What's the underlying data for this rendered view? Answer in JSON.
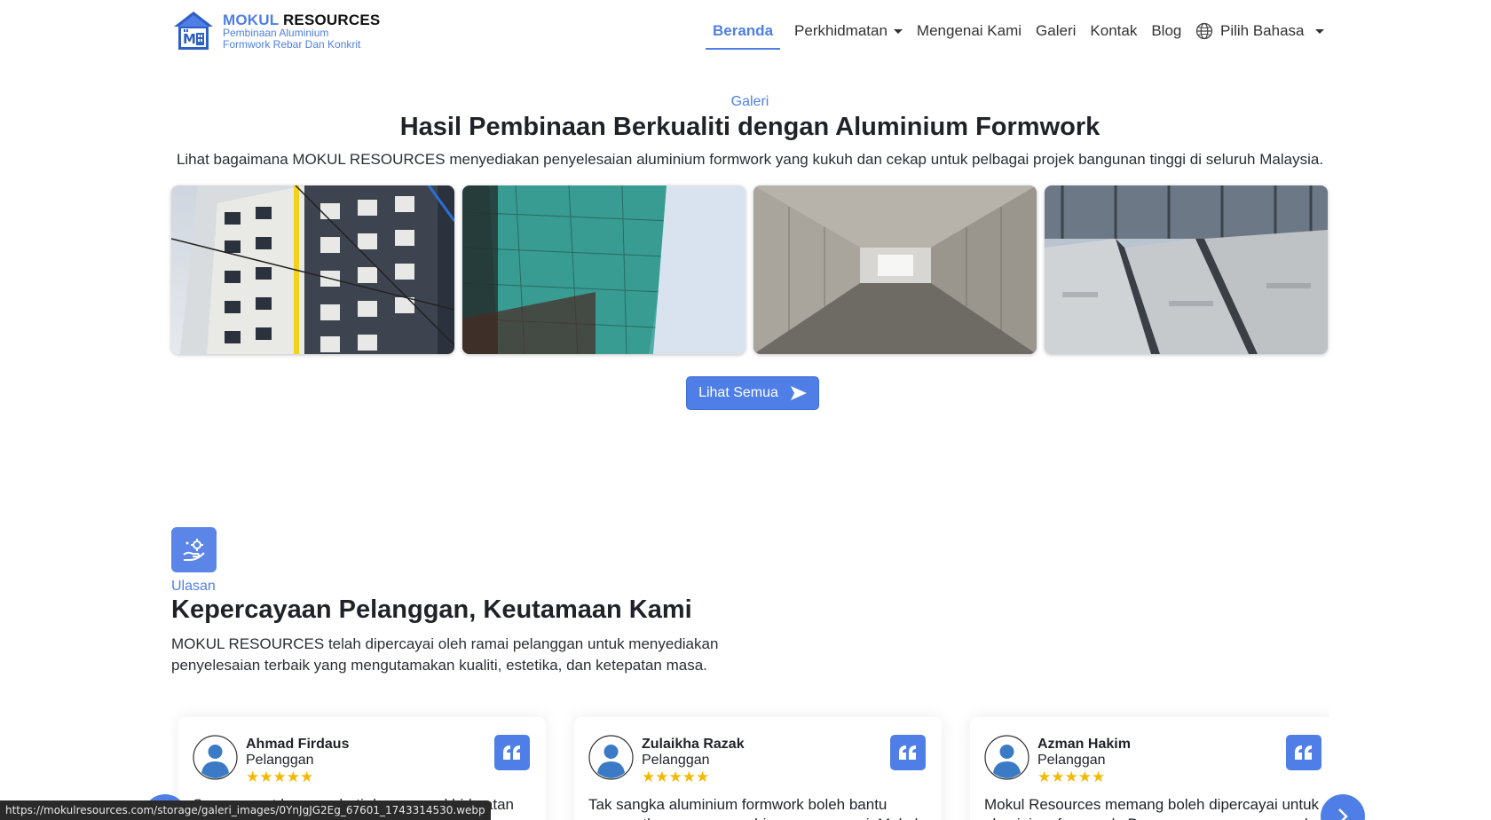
{
  "brand": {
    "name_accent": "MOKUL",
    "name_rest": "RESOURCES",
    "sub_line1": "Pembinaan Aluminium",
    "sub_line2": "Formwork Rebar Dan Konkrit"
  },
  "nav": {
    "items": [
      "Beranda",
      "Perkhidmatan",
      "Mengenai Kami",
      "Galeri",
      "Kontak",
      "Blog"
    ],
    "active": "Beranda",
    "language_label": "Pilih Bahasa"
  },
  "gallery": {
    "eyebrow": "Galeri",
    "title": "Hasil Pembinaan Berkualiti dengan Aluminium Formwork",
    "description": "Lihat bagaimana MOKUL RESOURCES menyediakan penyelesaian aluminium formwork yang kukuh dan cekap untuk pelbagai projek bangunan tinggi di seluruh Malaysia.",
    "view_all_label": "Lihat Semua"
  },
  "reviews": {
    "eyebrow": "Ulasan",
    "title": "Kepercayaan Pelanggan, Keutamaan Kami",
    "description": "MOKUL RESOURCES telah dipercayai oleh ramai pelanggan untuk menyediakan penyelesaian terbaik yang mengutamakan kualiti, estetika, dan ketepatan masa.",
    "cards": [
      {
        "name": "Ahmad Firdaus",
        "role": "Pelanggan",
        "rating": 5,
        "stars": "★★★★★",
        "text": "Saya sangat berpuas hati dengan perkhidmatan"
      },
      {
        "name": "Zulaikha Razak",
        "role": "Pelanggan",
        "rating": 5,
        "stars": "★★★★★",
        "text": "Tak sangka aluminium formwork boleh bantu percepatkan proses pembinaan macam ni. Mokul"
      },
      {
        "name": "Azman Hakim",
        "role": "Pelanggan",
        "rating": 5,
        "stars": "★★★★★",
        "text": "Mokul Resources memang boleh dipercayai untuk aluminium formwork. Proses pemasangan mereka"
      }
    ]
  },
  "status_bar": {
    "url": "https://mokulresources.com/storage/galeri_images/0YnJgJG2Eg_67601_1743314530.webp"
  },
  "colors": {
    "accent": "#4f7fe6",
    "star": "#f5b800",
    "text": "#1f2328"
  }
}
